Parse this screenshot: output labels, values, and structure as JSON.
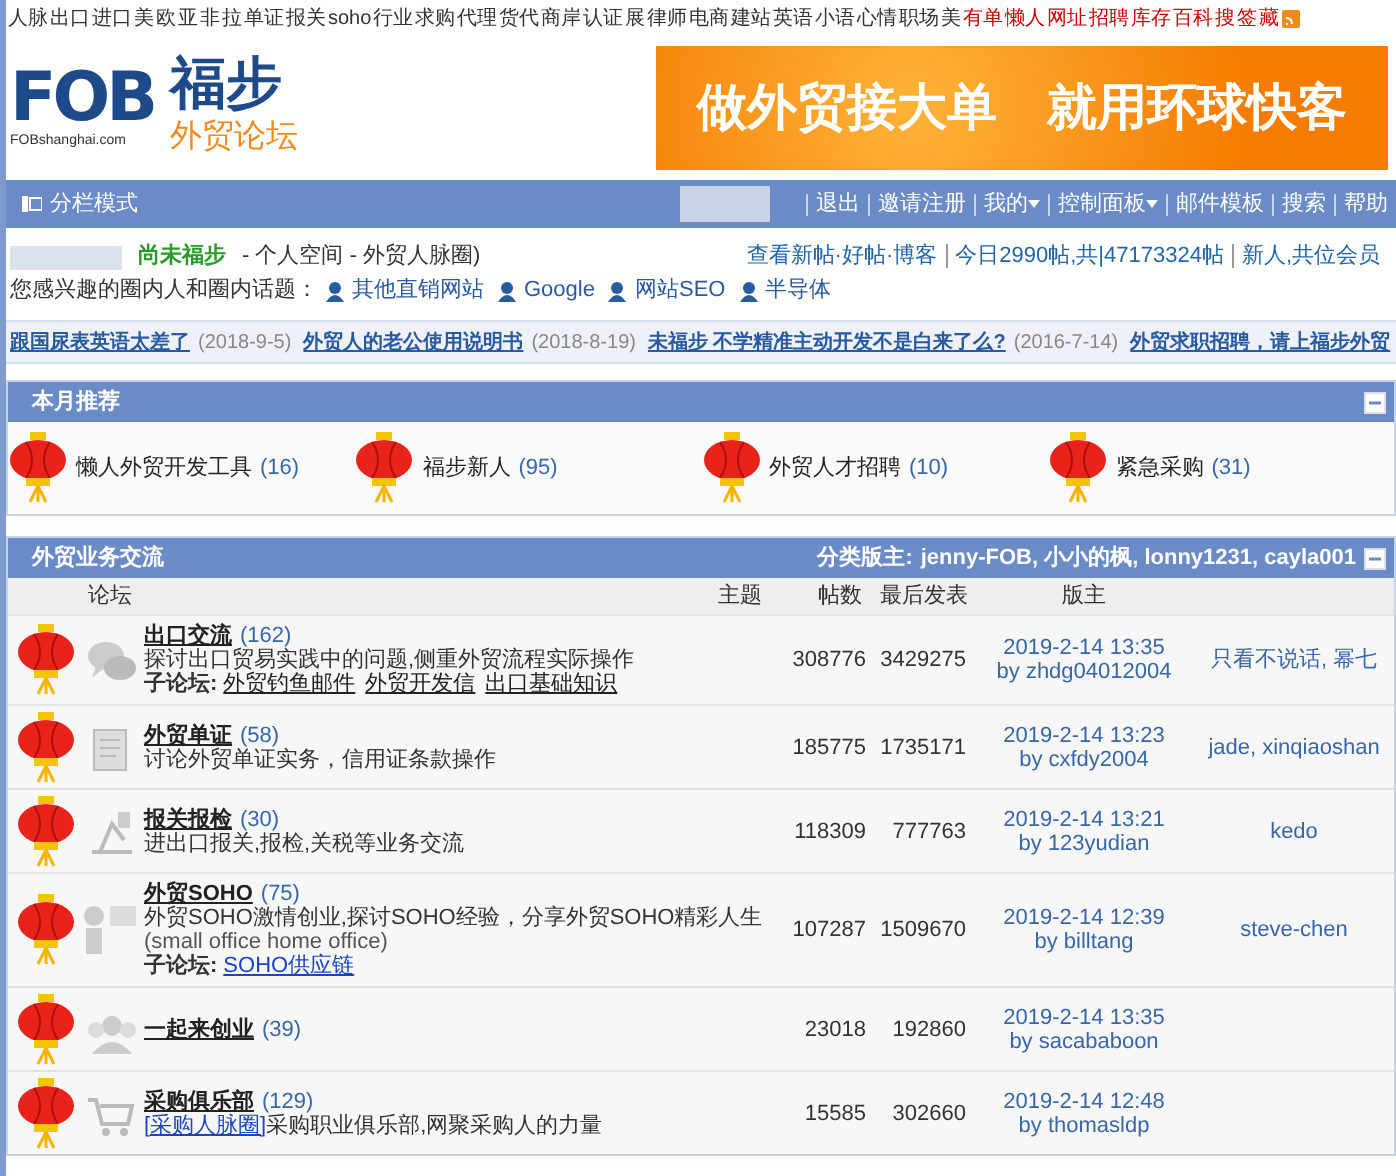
{
  "top_links": [
    {
      "label": "人脉",
      "color": "#333333"
    },
    {
      "label": "出口",
      "color": "#333333"
    },
    {
      "label": "进口",
      "color": "#333333"
    },
    {
      "label": "美",
      "color": "#333333"
    },
    {
      "label": "欧",
      "color": "#333333"
    },
    {
      "label": "亚",
      "color": "#333333"
    },
    {
      "label": "非",
      "color": "#333333"
    },
    {
      "label": "拉",
      "color": "#333333"
    },
    {
      "label": "单证",
      "color": "#333333"
    },
    {
      "label": "报关",
      "color": "#333333"
    },
    {
      "label": "soho",
      "color": "#333333"
    },
    {
      "label": "行业",
      "color": "#333333"
    },
    {
      "label": "求购",
      "color": "#333333"
    },
    {
      "label": "代理",
      "color": "#333333"
    },
    {
      "label": "货代",
      "color": "#333333"
    },
    {
      "label": "商岸",
      "color": "#333333"
    },
    {
      "label": "认证",
      "color": "#333333"
    },
    {
      "label": "展",
      "color": "#333333"
    },
    {
      "label": "律师",
      "color": "#333333"
    },
    {
      "label": "电商",
      "color": "#333333"
    },
    {
      "label": "建站",
      "color": "#333333"
    },
    {
      "label": "英语",
      "color": "#333333"
    },
    {
      "label": "小语",
      "color": "#333333"
    },
    {
      "label": "心情",
      "color": "#333333"
    },
    {
      "label": "职场",
      "color": "#333333"
    },
    {
      "label": "美",
      "color": "#333333"
    },
    {
      "label": "有单",
      "color": "#cc0000"
    },
    {
      "label": "懒人",
      "color": "#cc0000"
    },
    {
      "label": "网址",
      "color": "#cc0000"
    },
    {
      "label": "招聘",
      "color": "#cc0000"
    },
    {
      "label": "库存",
      "color": "#cc0000"
    },
    {
      "label": "百科",
      "color": "#cc0000"
    },
    {
      "label": "搜",
      "color": "#cc0000"
    },
    {
      "label": "签",
      "color": "#cc0000"
    },
    {
      "label": "藏",
      "color": "#cc0000"
    }
  ],
  "header": {
    "logo": {
      "mark": "FOB",
      "domain": "FOBshanghai.com",
      "name": "福步",
      "tagline": "外贸论坛"
    },
    "banner": {
      "text": "做外贸接大单　就用环球快客"
    }
  },
  "navbar": {
    "mode": "分栏模式",
    "links": [
      {
        "label": "退出",
        "dropdown": false
      },
      {
        "label": "邀请注册",
        "dropdown": false
      },
      {
        "label": "我的",
        "dropdown": true
      },
      {
        "label": "控制面板",
        "dropdown": true
      },
      {
        "label": "邮件模板",
        "dropdown": false
      },
      {
        "label": "搜索",
        "dropdown": false
      },
      {
        "label": "帮助",
        "dropdown": false
      }
    ]
  },
  "user_info": {
    "status": "尚未福步",
    "links_text": "- 个人空间 - 外贸人脉圈)",
    "stats": [
      "查看新帖·好帖·博客",
      "今日2990帖,共|47173324帖",
      "新人,共位会员"
    ],
    "interest_label": "您感兴趣的圈内人和圈内话题：",
    "interests": [
      "其他直销网站",
      "Google",
      "网站SEO",
      "半导体"
    ]
  },
  "headlines": [
    {
      "title": "跟国尿表英语太差了",
      "date": "(2018-9-5)"
    },
    {
      "title": "外贸人的老公使用说明书",
      "date": "(2018-8-19)"
    },
    {
      "title": "未福步 不学精准主动开发不是白来了么?",
      "date": "(2016-7-14)"
    },
    {
      "title": "外贸求职招聘，请上福步外贸"
    }
  ],
  "recommended": {
    "title": "本月推荐",
    "items": [
      {
        "name": "懒人外贸开发工具",
        "count": "(16)"
      },
      {
        "name": "福步新人",
        "count": "(95)"
      },
      {
        "name": "外贸人才招聘",
        "count": "(10)"
      },
      {
        "name": "紧急采购",
        "count": "(31)"
      }
    ]
  },
  "forum_section": {
    "title": "外贸业务交流",
    "moderators_label": "分类版主:",
    "moderators": "jenny-FOB, 小小的枫, lonny1231, cayla001",
    "columns": [
      "论坛",
      "主题",
      "帖数",
      "最后发表",
      "版主"
    ],
    "rows": [
      {
        "name": "出口交流",
        "count": "(162)",
        "description": "探讨出口贸易实践中的问题,侧重外贸流程实际操作",
        "subforum_label": "子论坛:",
        "subforums": [
          "外贸钓鱼邮件",
          "外贸开发信",
          "出口基础知识"
        ],
        "topics": "308776",
        "posts": "3429275",
        "last_time": "2019-2-14 13:35",
        "last_by": "by zhdg04012004",
        "moderators": "只看不说话, 幂七"
      },
      {
        "name": "外贸单证",
        "count": "(58)",
        "description": "讨论外贸单证实务，信用证条款操作",
        "topics": "185775",
        "posts": "1735171",
        "last_time": "2019-2-14 13:23",
        "last_by": "by cxfdy2004",
        "moderators": "jade, xinqiaoshan"
      },
      {
        "name": "报关报检",
        "count": "(30)",
        "description": "进出口报关,报检,关税等业务交流",
        "topics": "118309",
        "posts": "777763",
        "last_time": "2019-2-14 13:21",
        "last_by": "by 123yudian",
        "moderators": "kedo"
      },
      {
        "name": "外贸SOHO",
        "count": "(75)",
        "description": "外贸SOHO激情创业,探讨SOHO经验，分享外贸SOHO精彩人生",
        "note": "(small office home office)",
        "subforum_label": "子论坛:",
        "subforums": [
          "SOHO供应链"
        ],
        "topics": "107287",
        "posts": "1509670",
        "last_time": "2019-2-14 12:39",
        "last_by": "by billtang",
        "moderators": "steve-chen"
      },
      {
        "name": "一起来创业",
        "count": "(39)",
        "topics": "23018",
        "posts": "192860",
        "last_time": "2019-2-14 13:35",
        "last_by": "by sacababoon"
      },
      {
        "name": "采购俱乐部",
        "count": "(129)",
        "tag": "[采购人脉圈]",
        "description": "采购职业俱乐部,网聚采购人的力量",
        "topics": "15585",
        "posts": "302660",
        "last_time": "2019-2-14 12:48",
        "last_by": "by thomasldp"
      }
    ]
  }
}
